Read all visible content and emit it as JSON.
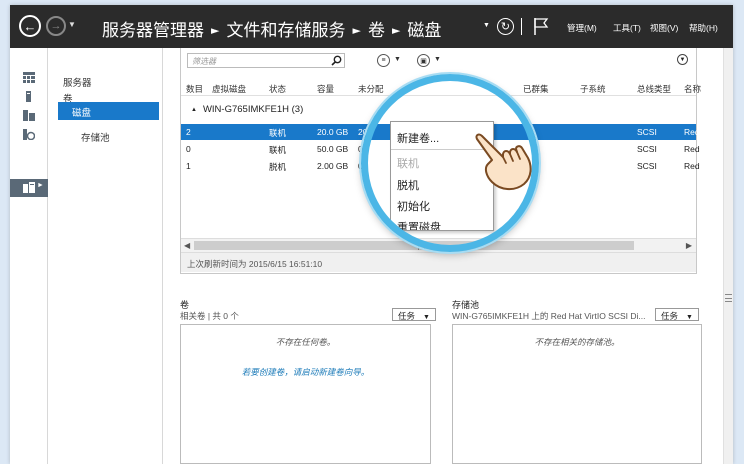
{
  "header": {
    "breadcrumb": [
      "服务器管理器",
      "文件和存储服务",
      "卷",
      "磁盘"
    ],
    "menus": [
      "管理(M)",
      "工具(T)",
      "视图(V)",
      "帮助(H)"
    ]
  },
  "subnav": {
    "items": [
      "服务器",
      "卷",
      "磁盘",
      "存储池"
    ],
    "selected_index": 2
  },
  "disks": {
    "filter_placeholder": "筛选器",
    "columns": [
      "数目",
      "虚拟磁盘",
      "状态",
      "容量",
      "未分配",
      "已群集",
      "子系统",
      "总线类型",
      "名称"
    ],
    "group": "WIN-G765IMKFE1H (3)",
    "rows": [
      {
        "num": "2",
        "status": "联机",
        "capacity": "20.0 GB",
        "unalloc": "20",
        "bus": "SCSI",
        "name": "Red"
      },
      {
        "num": "0",
        "status": "联机",
        "capacity": "50.0 GB",
        "unalloc": "0.",
        "bus": "SCSI",
        "name": "Red"
      },
      {
        "num": "1",
        "status": "脱机",
        "capacity": "2.00 GB",
        "unalloc": "0.",
        "bus": "SCSI",
        "name": "Red"
      }
    ],
    "selected_row": 0,
    "last_refresh": "上次刷新时间为 2015/6/15 16:51:10"
  },
  "volumes_panel": {
    "title": "卷",
    "subtitle": "相关卷 | 共 0 个",
    "task_label": "任务",
    "empty_message": "不存在任何卷。",
    "link_text": "若要创建卷，请启动新建卷向导。"
  },
  "pools_panel": {
    "title": "存储池",
    "subtitle": "WIN-G765IMKFE1H 上的 Red Hat VirtIO SCSI Di...",
    "task_label": "任务",
    "empty_message": "不存在相关的存储池。"
  },
  "context_menu": {
    "items": [
      "新建卷...",
      "联机",
      "脱机",
      "初始化",
      "重置磁盘"
    ],
    "disabled": [
      false,
      true,
      false,
      false,
      false
    ]
  },
  "colors": {
    "titlebar": "#2b2b2b",
    "selection": "#1979ca",
    "magnifier_ring": "#4bb6e6",
    "link": "#1a7ab8"
  }
}
